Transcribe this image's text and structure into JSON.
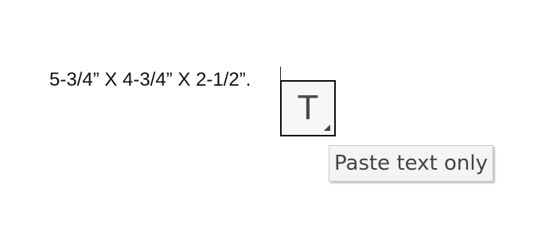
{
  "document": {
    "text": "5-3/4” X 4-3/4” X 2-1/2”."
  },
  "paste_options": {
    "icon": "text-only-paste-icon",
    "glyph": "T",
    "tooltip": "Paste text only"
  }
}
